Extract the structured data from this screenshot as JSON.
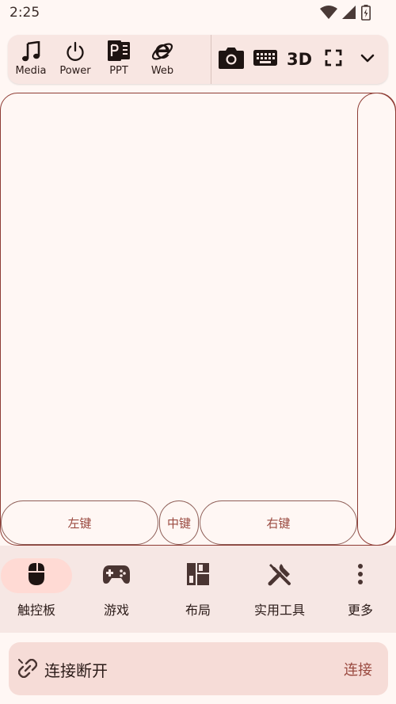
{
  "status_bar": {
    "time": "2:25",
    "icons": [
      "wifi-icon",
      "signal-icon",
      "battery-icon"
    ]
  },
  "shortcuts": [
    {
      "label": "Media",
      "icon": "music-note-icon"
    },
    {
      "label": "Power",
      "icon": "power-icon"
    },
    {
      "label": "PPT",
      "icon": "powerpoint-icon"
    },
    {
      "label": "Web",
      "icon": "internet-explorer-icon"
    }
  ],
  "tools": {
    "camera_icon": "camera-icon",
    "keyboard_icon": "keyboard-icon",
    "three_d_label": "3D",
    "fullscreen_icon": "fullscreen-icon",
    "expand_icon": "chevron-down-icon"
  },
  "mouse_buttons": {
    "left": "左键",
    "middle": "中键",
    "right": "右键"
  },
  "bottom_nav": {
    "items": [
      {
        "label": "触控板",
        "icon": "mouse-icon",
        "active": true
      },
      {
        "label": "游戏",
        "icon": "gamepad-icon",
        "active": false
      },
      {
        "label": "布局",
        "icon": "layout-icon",
        "active": false
      },
      {
        "label": "实用工具",
        "icon": "tools-icon",
        "active": false
      },
      {
        "label": "更多",
        "icon": "more-vert-icon",
        "active": false
      }
    ]
  },
  "connection": {
    "status": "连接断开",
    "action": "连接",
    "icon": "link-off-icon"
  },
  "colors": {
    "background": "#FFF7F4",
    "accent": "#9A4A40",
    "border": "#8E3C34",
    "active_pill": "#FFDAD4"
  }
}
